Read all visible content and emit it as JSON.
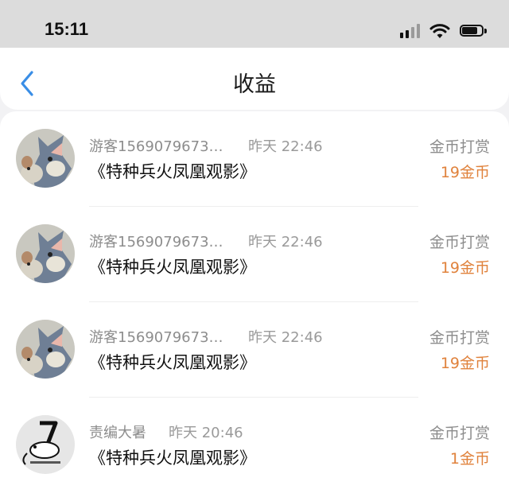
{
  "status_bar": {
    "time": "15:11",
    "icons": [
      "signal-icon",
      "wifi-icon",
      "battery-icon"
    ]
  },
  "nav": {
    "back_icon": "chevron-left-icon",
    "title": "收益",
    "accent_color": "#3a8ee6"
  },
  "colors": {
    "amount": "#e0823c",
    "secondary_text": "#8d8d8d"
  },
  "records": [
    {
      "user": "游客1569079673…",
      "time": "昨天 22:46",
      "book": "《特种兵火凤凰观影》",
      "type": "金币打赏",
      "amount": "19金币",
      "avatar": "cartoon-cat-avatar"
    },
    {
      "user": "游客1569079673…",
      "time": "昨天 22:46",
      "book": "《特种兵火凤凰观影》",
      "type": "金币打赏",
      "amount": "19金币",
      "avatar": "cartoon-cat-avatar"
    },
    {
      "user": "游客1569079673…",
      "time": "昨天 22:46",
      "book": "《特种兵火凤凰观影》",
      "type": "金币打赏",
      "amount": "19金币",
      "avatar": "cartoon-cat-avatar"
    },
    {
      "user": "责编大暑",
      "time": "昨天 20:46",
      "book": "《特种兵火凤凰观影》",
      "type": "金币打赏",
      "amount": "1金币",
      "avatar": "mouse-sketch-avatar"
    }
  ]
}
